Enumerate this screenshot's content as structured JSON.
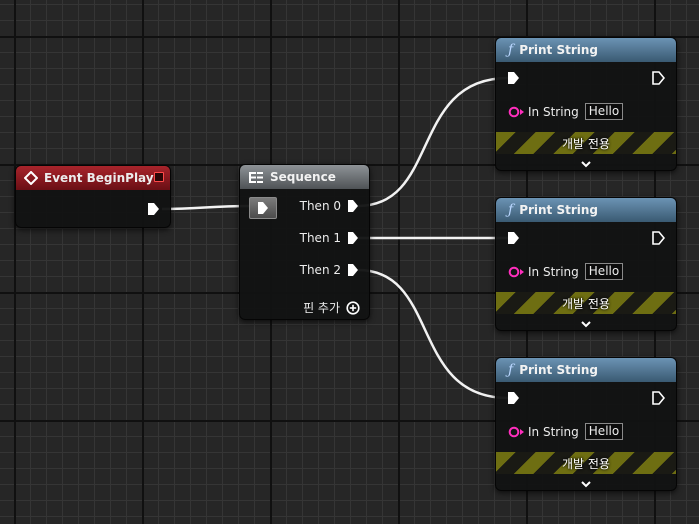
{
  "event_node": {
    "title": "Event BeginPlay"
  },
  "sequence_node": {
    "title": "Sequence",
    "pins": [
      "Then 0",
      "Then 1",
      "Then 2"
    ],
    "add_pin_label": "핀 추가"
  },
  "print_nodes": [
    {
      "title": "Print String",
      "pin_label": "In String",
      "value": "Hello",
      "dev_only_label": "개발 전용"
    },
    {
      "title": "Print String",
      "pin_label": "In String",
      "value": "Hello",
      "dev_only_label": "개발 전용"
    },
    {
      "title": "Print String",
      "pin_label": "In String",
      "value": "Hello",
      "dev_only_label": "개발 전용"
    }
  ],
  "icons": {
    "event": "event-diamond-icon",
    "sequence": "sequence-icon",
    "function": "function-icon",
    "exec_pin": "exec-pin-icon",
    "string_pin": "string-pin-icon",
    "add": "add-circle-icon",
    "expand": "chevron-down-icon",
    "delete": "delete-square-icon"
  },
  "colors": {
    "event_header": "#a8242b",
    "sequence_header": "#8e9397",
    "function_header": "#6b93b4",
    "string_pin": "#ff2ebd",
    "dev_strip": "#6e6e12"
  }
}
